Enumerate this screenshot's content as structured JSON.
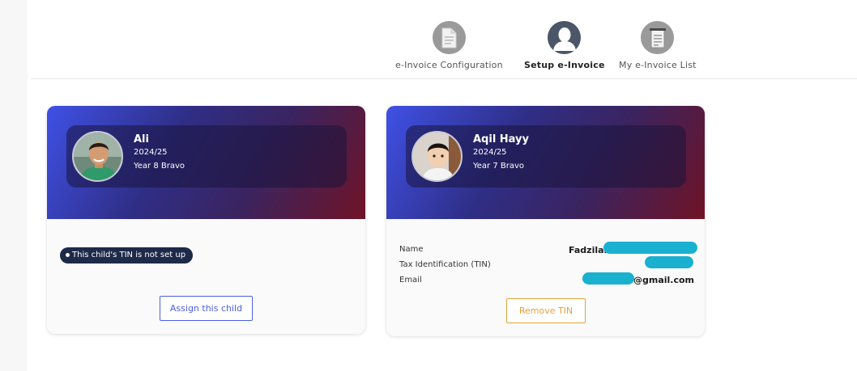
{
  "steps": [
    {
      "label": "e-Invoice Configuration",
      "icon": "document-icon",
      "active": false
    },
    {
      "label": "Setup e-Invoice",
      "icon": "user-icon",
      "active": true
    },
    {
      "label": "My e-Invoice List",
      "icon": "list-document-icon",
      "active": false
    }
  ],
  "children": [
    {
      "name": "Ali",
      "year": "2024/25",
      "class": "Year 8 Bravo",
      "tin_status": "This child's TIN is not set up",
      "action_label": "Assign this child"
    },
    {
      "name": "Aqil Hayy",
      "year": "2024/25",
      "class": "Year 7 Bravo",
      "info": {
        "name_label": "Name",
        "name_value": "Fadzilah",
        "tin_label": "Tax Identification (TIN)",
        "tin_value": "",
        "email_label": "Email",
        "email_value": "@gmail.com"
      },
      "action_label": "Remove TIN"
    }
  ],
  "colors": {
    "accent_blue": "#4a5fe6",
    "warning_orange": "#e2a23b",
    "redaction": "#1ab0d0",
    "badge_bg": "#1e2a4a"
  }
}
